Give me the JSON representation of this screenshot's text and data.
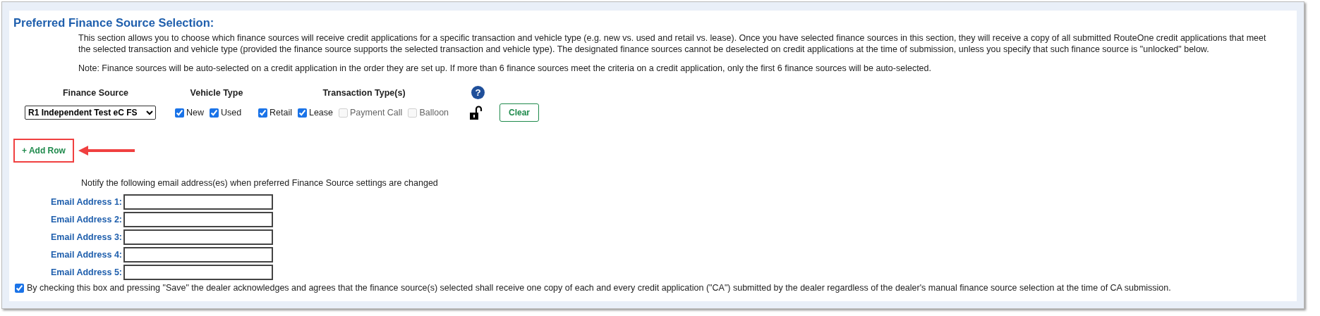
{
  "section": {
    "title": "Preferred Finance Source Selection:",
    "description": "This section allows you to choose which finance sources will receive credit applications for a specific transaction and vehicle type (e.g. new vs. used and retail vs. lease). Once you have selected finance sources in this section, they will receive a copy of all submitted RouteOne credit applications that meet the selected transaction and vehicle type (provided the finance source supports the selected transaction and vehicle type). The designated finance sources cannot be deselected on credit applications at the time of submission, unless you specify that such finance source is \"unlocked\" below.",
    "note": "Note: Finance sources will be auto-selected on a credit application in the order they are set up. If more than 6 finance sources meet the criteria on a credit application, only the first 6 finance sources will be auto-selected."
  },
  "table": {
    "columns": [
      "Finance Source",
      "Vehicle Type",
      "Transaction Type(s)"
    ],
    "help_icon": "?",
    "rows": [
      {
        "finance_source": "R1 Independent Test eC FS",
        "vehicle_types": [
          {
            "label": "New",
            "checked": true,
            "disabled": false
          },
          {
            "label": "Used",
            "checked": true,
            "disabled": false
          }
        ],
        "transaction_types": [
          {
            "label": "Retail",
            "checked": true,
            "disabled": false
          },
          {
            "label": "Lease",
            "checked": true,
            "disabled": false
          },
          {
            "label": "Payment Call",
            "checked": false,
            "disabled": true
          },
          {
            "label": "Balloon",
            "checked": false,
            "disabled": true
          }
        ],
        "locked": false,
        "clear_button": "Clear"
      }
    ]
  },
  "add_row_button": "+ Add Row",
  "notify": {
    "text": "Notify the following email address(es) when preferred Finance Source settings are changed",
    "emails": [
      {
        "label": "Email Address 1:"
      },
      {
        "label": "Email Address 2:"
      },
      {
        "label": "Email Address 3:"
      },
      {
        "label": "Email Address 4:"
      },
      {
        "label": "Email Address 5:"
      }
    ]
  },
  "acknowledgement": {
    "checked": true,
    "text": "By checking this box and pressing \"Save\" the dealer acknowledges and agrees that the finance source(s) selected shall receive one copy of each and every credit application (\"CA\") submitted by the dealer regardless of the dealer's manual finance source selection at the time of CA submission."
  }
}
